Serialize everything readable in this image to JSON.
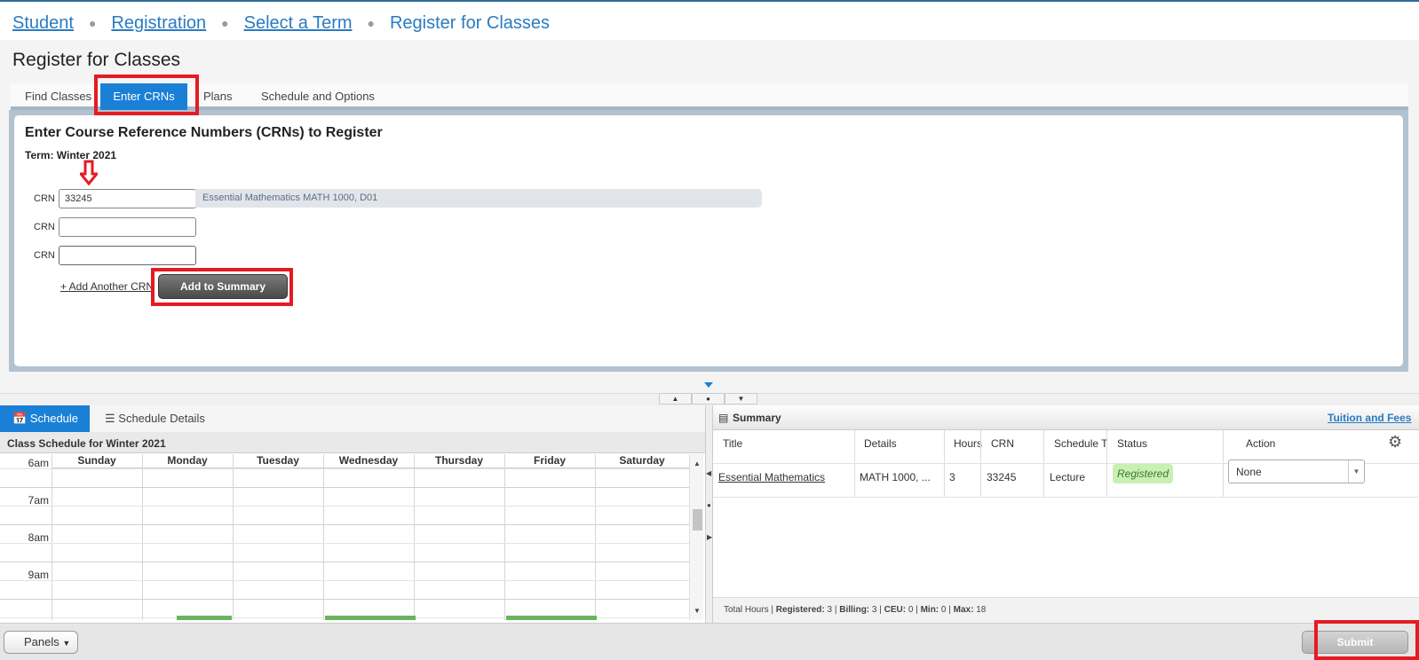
{
  "breadcrumb": {
    "items": [
      "Student",
      "Registration",
      "Select a Term"
    ],
    "current": "Register for Classes"
  },
  "page_title": "Register for Classes",
  "tabs": [
    "Find Classes",
    "Enter CRNs",
    "Plans",
    "Schedule and Options"
  ],
  "enter_crns": {
    "heading": "Enter Course Reference Numbers (CRNs) to Register",
    "term": "Term: Winter 2021",
    "crn_label": "CRN",
    "rows": [
      {
        "value": "33245",
        "description": "Essential Mathematics MATH 1000, D01"
      },
      {
        "value": ""
      },
      {
        "value": ""
      }
    ],
    "add_another": "+ Add Another CRN",
    "add_to_summary": "Add to Summary"
  },
  "schedule": {
    "tab_schedule": "Schedule",
    "tab_details": "Schedule Details",
    "title": "Class Schedule for Winter 2021",
    "days": [
      "Sunday",
      "Monday",
      "Tuesday",
      "Wednesday",
      "Thursday",
      "Friday",
      "Saturday"
    ],
    "hours": [
      "6am",
      "7am",
      "8am",
      "9am"
    ]
  },
  "summary": {
    "title": "Summary",
    "tuition_link": "Tuition and Fees",
    "columns": [
      "Title",
      "Details",
      "Hours",
      "CRN",
      "Schedule T",
      "Status",
      "Action"
    ],
    "row": {
      "title": "Essential Mathematics",
      "details": "MATH 1000, ...",
      "hours": "3",
      "crn": "33245",
      "schedule_type": "Lecture",
      "status": "Registered",
      "action": "None"
    },
    "totals": {
      "prefix": "Total Hours | ",
      "registered_label": "Registered:",
      "registered": "3",
      "billing_label": "Billing:",
      "billing": "3",
      "ceu_label": "CEU:",
      "ceu": "0",
      "min_label": "Min:",
      "min": "0",
      "max_label": "Max:",
      "max": "18"
    }
  },
  "footer": {
    "panels": "Panels",
    "submit": "Submit"
  },
  "colors": {
    "accent": "#1a80d6",
    "annotation_red": "#e41b23",
    "registered_bg": "#c9f0b4"
  }
}
